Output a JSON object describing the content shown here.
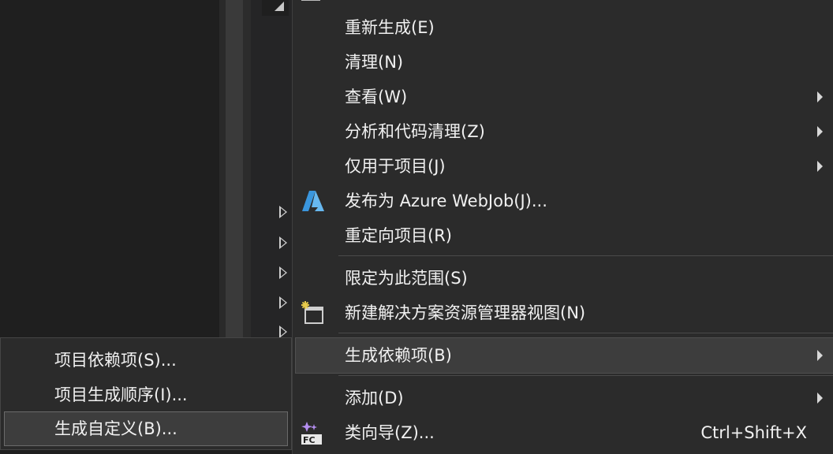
{
  "context_menu": {
    "items": [
      {
        "label": "重新生成(E)",
        "has_submenu": false
      },
      {
        "label": "清理(N)",
        "has_submenu": false
      },
      {
        "label": "查看(W)",
        "has_submenu": true
      },
      {
        "label": "分析和代码清理(Z)",
        "has_submenu": true
      },
      {
        "label": "仅用于项目(J)",
        "has_submenu": true
      },
      {
        "label": "发布为 Azure WebJob(J)...",
        "icon": "azure-icon",
        "has_submenu": false
      },
      {
        "label": "重定向项目(R)",
        "has_submenu": false
      },
      {
        "label": "限定为此范围(S)",
        "has_submenu": false
      },
      {
        "label": "新建解决方案资源管理器视图(N)",
        "icon": "new-view-icon",
        "has_submenu": false
      },
      {
        "label": "生成依赖项(B)",
        "has_submenu": true,
        "highlighted": true
      },
      {
        "label": "添加(D)",
        "has_submenu": true
      },
      {
        "label": "类向导(Z)...",
        "icon": "class-wizard-icon",
        "shortcut": "Ctrl+Shift+X",
        "has_submenu": false
      }
    ]
  },
  "submenu": {
    "items": [
      {
        "label": "项目依赖项(S)..."
      },
      {
        "label": "项目生成顺序(I)..."
      },
      {
        "label": "生成自定义(B)...",
        "highlighted": true
      }
    ]
  },
  "colors": {
    "menu_background": "#2b2b2b",
    "highlight": "#3d3d3d",
    "text": "#f1f1f1",
    "azure_blue": "#3a96dd"
  }
}
